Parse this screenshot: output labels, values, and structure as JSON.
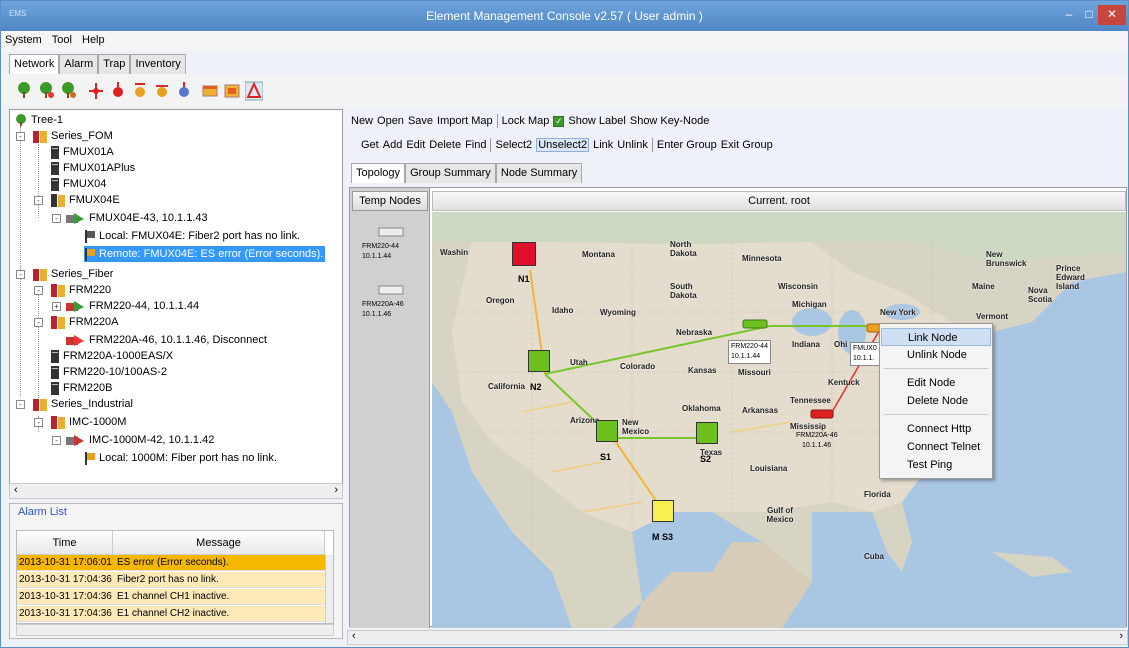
{
  "window": {
    "title": "Element Management Console v2.57 ( User admin )",
    "icon": "app-icon",
    "controls": [
      "minimize-icon",
      "maximize-icon",
      "close-icon"
    ]
  },
  "menu": [
    "System",
    "Tool",
    "Help"
  ],
  "main_tabs": [
    "Network",
    "Alarm",
    "Trap",
    "Inventory"
  ],
  "tree": [
    {
      "label": "Tree-1"
    },
    {
      "label": "Series_FOM"
    },
    {
      "label": "FMUX01A"
    },
    {
      "label": "FMUX01APlus"
    },
    {
      "label": "FMUX04"
    },
    {
      "label": "FMUX04E"
    },
    {
      "label": "FMUX04E-43, 10.1.1.43"
    },
    {
      "label": "Local: FMUX04E: Fiber2 port has no link."
    },
    {
      "label": "Remote: FMUX04E: ES error (Error seconds)."
    },
    {
      "label": "Series_Fiber"
    },
    {
      "label": "FRM220"
    },
    {
      "label": "FRM220-44, 10.1.1.44"
    },
    {
      "label": "FRM220A"
    },
    {
      "label": "FRM220A-46, 10.1.1.46, Disconnect"
    },
    {
      "label": "FRM220A-1000EAS/X"
    },
    {
      "label": "FRM220-10/100AS-2"
    },
    {
      "label": "FRM220B"
    },
    {
      "label": "Series_Industrial"
    },
    {
      "label": "IMC-1000M"
    },
    {
      "label": "IMC-1000M-42, 10.1.1.42"
    },
    {
      "label": "Local: 1000M: Fiber port has no link."
    }
  ],
  "alarm_list": {
    "title": "Alarm List",
    "columns": [
      "Time",
      "Message"
    ],
    "rows": [
      {
        "time": "2013-10-31 17:06:01",
        "message": "ES error (Error seconds)."
      },
      {
        "time": "2013-10-31 17:04:36",
        "message": "Fiber2 port has no link."
      },
      {
        "time": "2013-10-31 17:04:36",
        "message": "E1 channel CH1 inactive."
      },
      {
        "time": "2013-10-31 17:04:36",
        "message": "E1 channel CH2 inactive."
      }
    ]
  },
  "topo_toolbar1": {
    "new": "New",
    "open": "Open",
    "save": "Save",
    "import": "Import Map",
    "lock": "Lock Map",
    "show_label": "Show Label",
    "show_key": "Show Key-Node"
  },
  "topo_toolbar2": {
    "get": "Get",
    "add": "Add",
    "edit": "Edit",
    "delete": "Delete",
    "find": "Find",
    "select2": "Select2",
    "unselect2": "Unselect2",
    "link": "Link",
    "unlink": "Unlink",
    "enter": "Enter Group",
    "exit": "Exit Group"
  },
  "inner_tabs": [
    "Topology",
    "Group Summary",
    "Node Summary"
  ],
  "temp_nodes": {
    "header": "Temp Nodes",
    "items": [
      {
        "name": "FRM220-44",
        "ip": "10.1.1.44"
      },
      {
        "name": "FRM220A-46",
        "ip": "10.1.1.46"
      }
    ]
  },
  "current_header": "Current. root",
  "map": {
    "labels": [
      "Washin",
      "Montana",
      "North Dakota",
      "Minnesota",
      "South Dakota",
      "Wisconsin",
      "Michigan",
      "New York",
      "Oregon",
      "Idaho",
      "Wyoming",
      "Nebraska",
      "Utah",
      "Colorado",
      "Kansas",
      "Missouri",
      "California",
      "Oklahoma",
      "Arkansas",
      "Tennessee",
      "Arizona",
      "New Mexico",
      "Texas",
      "Louisiana",
      "Mississip",
      "Kentuck",
      "Maine",
      "Vermont",
      "Gulf of Mexico",
      "Cuba",
      "Florida",
      "Nova Scotia",
      "New Brunswick",
      "Prince Edward Island",
      "Indiana",
      "Ohi"
    ],
    "nodes": [
      {
        "name": "N1",
        "color": "#e0102a"
      },
      {
        "name": "N2",
        "color": "#6cc11e"
      },
      {
        "name": "S1",
        "color": "#6cc11e"
      },
      {
        "name": "S2",
        "color": "#6cc11e"
      },
      {
        "name": "S3",
        "color": "#f8ef50",
        "prefix": "M"
      }
    ],
    "devices": [
      {
        "name": "FRM220-44",
        "ip": "10.1.1.44"
      },
      {
        "name": "FMUX0",
        "ip": "10.1.1."
      },
      {
        "name": "FRM220A-46",
        "ip": "10.1.1.46"
      }
    ]
  },
  "context_menu": {
    "items": [
      "Link Node",
      "Unlink Node",
      "Edit Node",
      "Delete Node",
      "Connect Http",
      "Connect Telnet",
      "Test Ping"
    ]
  }
}
